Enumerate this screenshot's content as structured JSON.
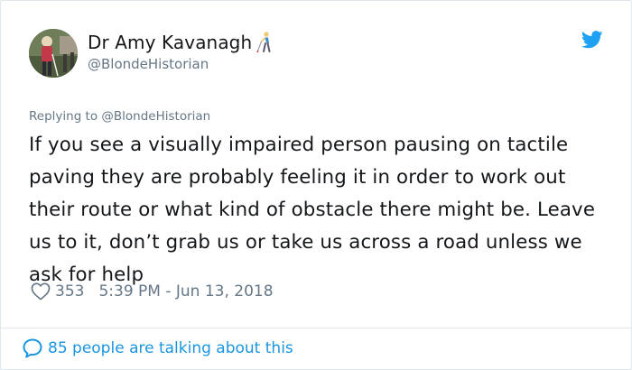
{
  "author": {
    "display_name": "Dr Amy Kavanagh",
    "handle": "@BlondeHistorian",
    "avatar_icon": "person-photo-avatar",
    "name_emoji_icon": "person-with-white-cane-icon"
  },
  "platform_icon": "twitter-bird-icon",
  "reply": {
    "prefix": "Replying to",
    "to": "@BlondeHistorian"
  },
  "tweet": {
    "text": "If you see a visually impaired person pausing on tactile paving they are probably feeling it in order to work out their route or what kind of obstacle there might be. Leave us to it, don’t grab us or take us across a road unless we ask for help",
    "likes": "353",
    "timestamp": "5:39 PM - Jun 13, 2018"
  },
  "footer": {
    "talking_text": "85 people are talking about this"
  },
  "colors": {
    "accent": "#1b95e0",
    "muted": "#657786",
    "text": "#14171a",
    "border": "#e1e8ed"
  }
}
